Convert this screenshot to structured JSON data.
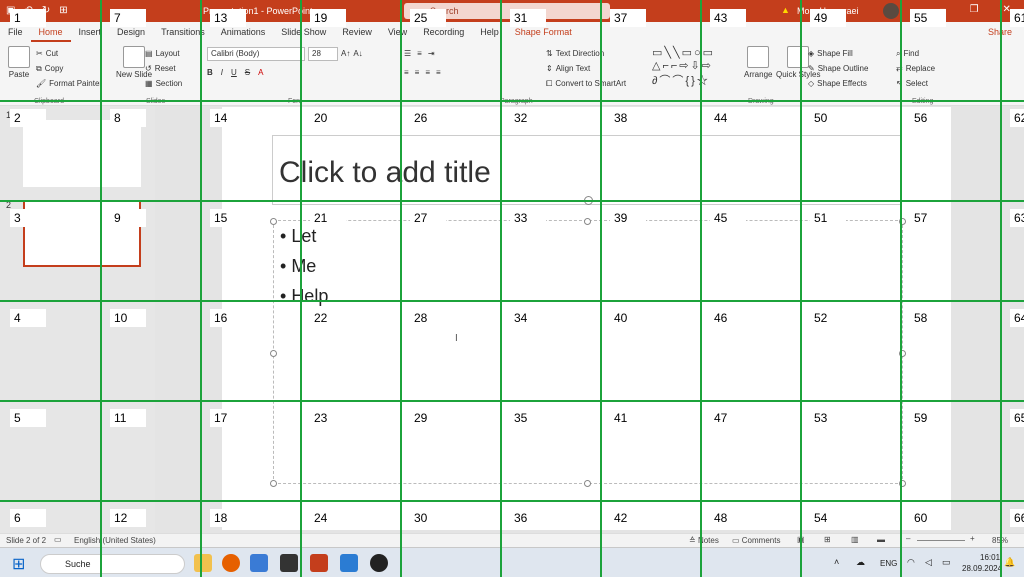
{
  "app": {
    "doc_title": "Presentation1 - PowerPoint",
    "search_placeholder": "Search",
    "account": "Mo... Homaraei",
    "share": "Share"
  },
  "tabs": [
    "File",
    "Home",
    "Insert",
    "Design",
    "Transitions",
    "Animations",
    "Slide Show",
    "Review",
    "View",
    "Recording",
    "Help",
    "Shape Format"
  ],
  "ribbon": {
    "clipboard": {
      "paste": "Paste",
      "cut": "Cut",
      "copy": "Copy",
      "format_painter": "Format Painter",
      "label": "Clipboard"
    },
    "slides": {
      "new_slide": "New Slide",
      "layout": "Layout",
      "reset": "Reset",
      "section": "Section",
      "label": "Slides"
    },
    "font": {
      "name": "Calibri (Body)",
      "size": "28",
      "label": "Font"
    },
    "paragraph": {
      "text_direction": "Text Direction",
      "align_text": "Align Text",
      "convert_smartart": "Convert to SmartArt",
      "label": "Paragraph"
    },
    "drawing": {
      "arrange": "Arrange",
      "quick_styles": "Quick Styles",
      "shape_fill": "Shape Fill",
      "shape_outline": "Shape Outline",
      "shape_effects": "Shape Effects",
      "label": "Drawing"
    },
    "editing": {
      "find": "Find",
      "replace": "Replace",
      "select": "Select",
      "label": "Editing"
    }
  },
  "slides": {
    "thumb1": "1",
    "thumb2": "2"
  },
  "slide": {
    "title": "Click to add title",
    "bullets": [
      "Let",
      "Me",
      "Help"
    ]
  },
  "status": {
    "slide_info": "Slide 2 of 2",
    "language": "English (United States)",
    "notes": "Notes",
    "comments": "Comments",
    "zoom": "85%"
  },
  "taskbar": {
    "search": "Suche",
    "lang": "ENG",
    "time": "16:01",
    "date": "28.09.2024"
  },
  "grid": {
    "labels": [
      "1",
      "7",
      "13",
      "19",
      "25",
      "31",
      "37",
      "43",
      "49",
      "55",
      "61",
      "2",
      "8",
      "14",
      "20",
      "26",
      "32",
      "38",
      "44",
      "50",
      "56",
      "62",
      "3",
      "9",
      "15",
      "21",
      "27",
      "33",
      "39",
      "45",
      "51",
      "57",
      "63",
      "4",
      "10",
      "16",
      "22",
      "28",
      "34",
      "40",
      "46",
      "52",
      "58",
      "64",
      "5",
      "11",
      "17",
      "23",
      "29",
      "35",
      "41",
      "47",
      "53",
      "59",
      "65",
      "6",
      "12",
      "18",
      "24",
      "30",
      "36",
      "42",
      "48",
      "54",
      "60",
      "66"
    ]
  },
  "colors": {
    "accent": "#c43e1c",
    "grid": "#1ca33b"
  }
}
